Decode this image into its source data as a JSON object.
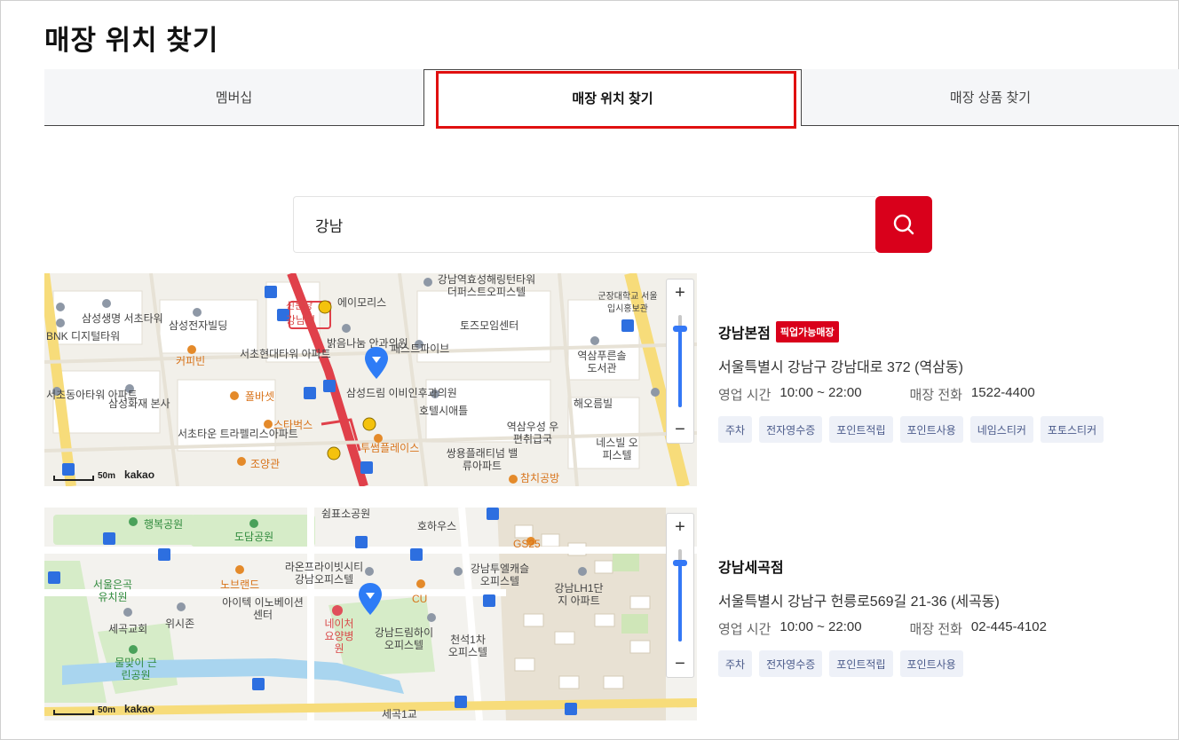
{
  "page_title": "매장 위치 찾기",
  "tabs": [
    {
      "label": "멤버십"
    },
    {
      "label": "매장 위치 찾기"
    },
    {
      "label": "매장 상품 찾기"
    }
  ],
  "search": {
    "value": "강남"
  },
  "colors": {
    "accent": "#d9001b",
    "highlight": "#e01010",
    "chip_bg": "#eef1f8"
  },
  "stores": [
    {
      "name": "강남본점",
      "badge": "픽업가능매장",
      "address": "서울특별시 강남구 강남대로 372 (역삼동)",
      "hours_label": "영업 시간",
      "hours": "10:00 ~ 22:00",
      "phone_label": "매장 전화",
      "phone": "1522-4400",
      "services": [
        "주차",
        "전자영수증",
        "포인트적립",
        "포인트사용",
        "네임스티커",
        "포토스티커"
      ],
      "map": {
        "scale": "50m",
        "provider": "kakao",
        "labels": [
          "삼성생명 서초타워",
          "BNK 디지털타워",
          "삼성전자빌딩",
          "커피빈",
          "서초현대타워 아파트",
          "서초동아타워 아파트",
          "삼성화재 본사",
          "폴바셋",
          "스타벅스",
          "서초타운 트라펠리스아파트",
          "조양관",
          "밝음나눔 안과의원",
          "삼성드림 이비인후과의원",
          "투썸플레이스",
          "패스트파이브",
          "호텔시애틀",
          "강남역효성해링턴타워 더퍼스트오피스텔",
          "토즈모임센터",
          "역삼푸른솔 도서관",
          "군장대학교 서울입시홍보관",
          "해오름빌",
          "역삼우성 우편취급국",
          "쌍용플래티넘 밸류아파트",
          "네스빌 오피스텔",
          "참치공방",
          "신분당",
          "강남역",
          "에이모리스"
        ]
      }
    },
    {
      "name": "강남세곡점",
      "badge": "",
      "address": "서울특별시 강남구 헌릉로569길 21-36 (세곡동)",
      "hours_label": "영업 시간",
      "hours": "10:00 ~ 22:00",
      "phone_label": "매장 전화",
      "phone": "02-445-4102",
      "services": [
        "주차",
        "전자영수증",
        "포인트적립",
        "포인트사용"
      ],
      "map": {
        "scale": "50m",
        "provider": "kakao",
        "labels": [
          "행복공원",
          "도담공원",
          "쉼표소공원",
          "호하우스",
          "GS25",
          "서울은곡 유치원",
          "노브랜드",
          "라온프라이빗시티 강남오피스텔",
          "강남투엘캐슬 오피스텔",
          "강남LH1단지 아파트",
          "세곡교회",
          "위시존",
          "아이텍 이노베이션센터",
          "네이처 요양병원",
          "CU",
          "강남드림하이 오피스텔",
          "천석1차 오피스텔",
          "물맞이 근린공원",
          "세곡1교"
        ]
      }
    }
  ]
}
